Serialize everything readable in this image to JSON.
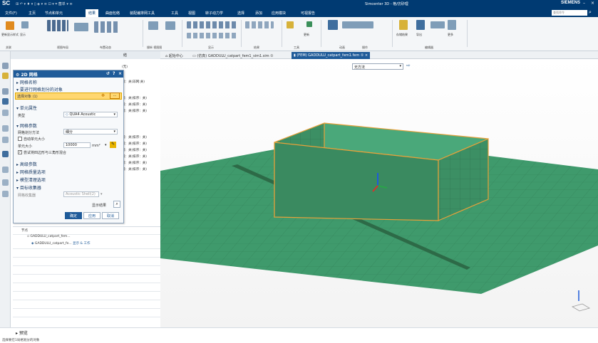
{
  "app": {
    "logo": "SC",
    "title": "Simcenter 3D - 格/仿砂理",
    "brand": "SIEMENS",
    "quick_access": "⊞ ↶ ▾ ♦ ▾ ▯ ◈ ▾ ≡ ⊡ ▾ ⌗ 菌单 ▾ ≡"
  },
  "menu": {
    "items": [
      "文件(F)",
      "主页",
      "节点和单元",
      "结果",
      "曲面包络",
      "装配编排网工具",
      "工具",
      "视图",
      "转子动力学",
      "选择",
      "添加",
      "应用模块",
      "可视报告"
    ],
    "search_placeholder": "查找命令"
  },
  "ribbon": {
    "groups": [
      "关联",
      "视图布局",
      "布置动态",
      "操纵 视图图",
      "显示",
      "结果",
      "工具",
      "动画",
      "操作",
      "编辑器"
    ],
    "labels": [
      "更新显示样式",
      "显示",
      "更新",
      "返回",
      "导出",
      "更多",
      "存储结果",
      "动画",
      "后处理",
      "选取",
      "视图"
    ]
  },
  "nav_header": "结",
  "nav_lines": [
    "(无)",
    "浦：关(非网:关)",
    "浦：关(排序：关)",
    "浦：关(排序：关)",
    "浦：关(排序：关)",
    "浦：关(排序：关)",
    "浦：关(排序：关)",
    "浦：关(排序：关)",
    "浦：关(排序：关)",
    "浦：关(排序：关)",
    "浦：关(排序：关)"
  ],
  "dialog": {
    "title": "2D 网格",
    "sec_mesh_name": "网格名称",
    "sec_select": "要进行网格划分的对象",
    "select_objects": "选择对象 (1)",
    "sec_element": "单元属性",
    "type_label": "类型",
    "type_value": "QUA4 Acoustic",
    "sec_params": "网格参数",
    "method_label": "网格划分方法",
    "method_value": "细分",
    "auto_size_label": "自动单元大小",
    "size_label": "单元大小",
    "size_value": "10000",
    "size_unit": "mm²",
    "mixed_label": "尝试将四边形与三角形混合",
    "sec_geom": "高级参数",
    "sec_quality": "网格质量选项",
    "sec_cleanup": "模型清理选项",
    "sec_target": "目标收集器",
    "collector_label": "网格收集器",
    "collector_value": "Acoustic Shell(2)",
    "show_results": "显示结果",
    "ok": "确定",
    "apply": "应用",
    "cancel": "取消"
  },
  "tree": {
    "root": "节点",
    "item1": "GADDULU_catpart_fem...",
    "item2": "GADDULU_catpart_fe...",
    "item2_suffix": "显示 & 工作"
  },
  "tabs": [
    {
      "label": "起始中心"
    },
    {
      "label": "(仿真) GADDULU_catpart_fem1_sim1.sim ①"
    },
    {
      "label": "(FEM) GADDULU_catpart_fem1.fem ① ×"
    }
  ],
  "viewport_filter": "无方法",
  "status": {
    "preview": "预览",
    "text": "选择要在1局格划分的对象"
  },
  "colors": {
    "accent": "#1f5b99",
    "mesh_green": "#3f9a6c",
    "edge_orange": "#e8a13a",
    "titlebar": "#003a72"
  }
}
